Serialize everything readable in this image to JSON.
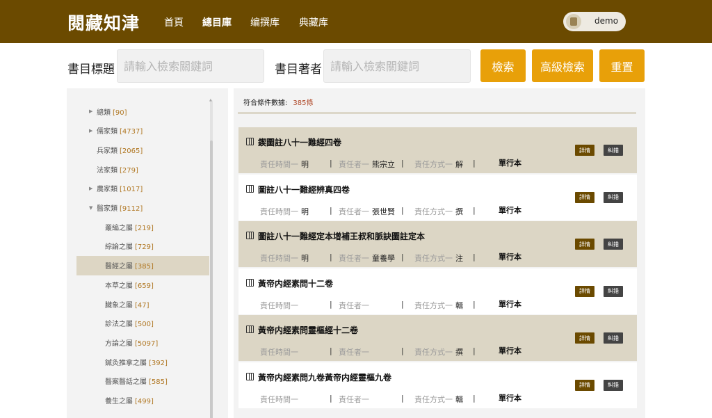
{
  "header": {
    "logo": "閱藏知津",
    "nav": [
      "首頁",
      "總目庫",
      "编撰库",
      "典藏库"
    ],
    "active_nav": "總目庫",
    "user": "demo"
  },
  "search": {
    "title_label": "書目標題",
    "title_placeholder": "請輸入檢索關鍵詞",
    "author_label": "書目著者",
    "author_placeholder": "請輸入檢索關鍵詞",
    "search_btn": "檢索",
    "advanced_btn": "高級檢索",
    "reset_btn": "重置"
  },
  "sidebar": {
    "items": [
      {
        "label": "總類",
        "count": "[90]",
        "level": 1,
        "arrow": "right"
      },
      {
        "label": "儒家類",
        "count": "[4737]",
        "level": 1,
        "arrow": "right"
      },
      {
        "label": "兵家類",
        "count": "[2065]",
        "level": 1,
        "arrow": ""
      },
      {
        "label": "法家類",
        "count": "[279]",
        "level": 1,
        "arrow": ""
      },
      {
        "label": "農家類",
        "count": "[1017]",
        "level": 1,
        "arrow": "right"
      },
      {
        "label": "醫家類",
        "count": "[9112]",
        "level": 1,
        "arrow": "down"
      },
      {
        "label": "叢編之屬",
        "count": "[219]",
        "level": 2,
        "arrow": ""
      },
      {
        "label": "綜論之屬",
        "count": "[729]",
        "level": 2,
        "arrow": ""
      },
      {
        "label": "醫經之屬",
        "count": "[385]",
        "level": 2,
        "arrow": "",
        "selected": true
      },
      {
        "label": "本草之屬",
        "count": "[659]",
        "level": 2,
        "arrow": ""
      },
      {
        "label": "臟象之屬",
        "count": "[47]",
        "level": 2,
        "arrow": ""
      },
      {
        "label": "診法之屬",
        "count": "[500]",
        "level": 2,
        "arrow": ""
      },
      {
        "label": "方論之屬",
        "count": "[5097]",
        "level": 2,
        "arrow": ""
      },
      {
        "label": "鍼灸推拿之屬",
        "count": "[392]",
        "level": 2,
        "arrow": ""
      },
      {
        "label": "醫案醫話之屬",
        "count": "[585]",
        "level": 2,
        "arrow": ""
      },
      {
        "label": "養生之屬",
        "count": "[499]",
        "level": 2,
        "arrow": ""
      }
    ]
  },
  "results": {
    "count_label": "符合條件數據:",
    "count_value": "385條",
    "labels": {
      "time": "責任時間一",
      "person": "責任者一",
      "mode": "責任方式一",
      "detail": "詳情",
      "correct": "糾錯"
    },
    "items": [
      {
        "title": "鍥圖註八十一難經四卷",
        "time": "明",
        "person": "熊宗立",
        "mode": "解",
        "edition": "單行本"
      },
      {
        "title": "圖註八十一難經辨真四卷",
        "time": "明",
        "person": "張世賢",
        "mode": "撰",
        "edition": "單行本"
      },
      {
        "title": "圖註八十一難經定本增補王叔和脈訣圖註定本",
        "time": "明",
        "person": "童養學",
        "mode": "注",
        "edition": "單行本"
      },
      {
        "title": "黃帝内經素問十二卷",
        "time": "",
        "person": "",
        "mode": "輯",
        "edition": "單行本"
      },
      {
        "title": "黃帝内經素問靈樞經十二卷",
        "time": "",
        "person": "",
        "mode": "撰",
        "edition": "單行本"
      },
      {
        "title": "黃帝内經素問九卷黃帝内經靈樞九卷",
        "time": "",
        "person": "",
        "mode": "輯",
        "edition": "單行本"
      }
    ]
  },
  "colors": {
    "header_bg": "#6b4a00",
    "accent_button": "#e8a009",
    "selected_row": "#ddd6c4",
    "shaded_card": "#dcd6c5",
    "count_number": "#b07722"
  }
}
